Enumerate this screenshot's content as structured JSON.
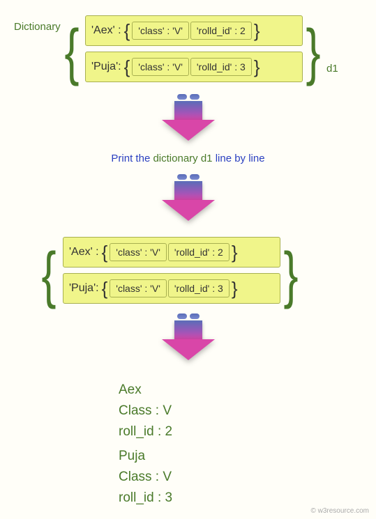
{
  "labels": {
    "dictionary": "Dictionary",
    "d1": "d1"
  },
  "caption": {
    "prefix": "Print the",
    "mid": " dictionary d1 ",
    "suffix": "line by line"
  },
  "dict1": {
    "row1": {
      "key": "'Aex' :",
      "kv1": "'class' : 'V'",
      "kv2": "'rolld_id' : 2"
    },
    "row2": {
      "key": "'Puja':",
      "kv1": "'class' : 'V'",
      "kv2": "'rolld_id' : 3"
    }
  },
  "dict2": {
    "row1": {
      "key": "'Aex' :",
      "kv1": "'class' : 'V'",
      "kv2": "'rolld_id' : 2"
    },
    "row2": {
      "key": "'Puja':",
      "kv1": "'class' : 'V'",
      "kv2": "'rolld_id' : 3"
    }
  },
  "output": {
    "l1": "Aex",
    "l2": "Class : V",
    "l3": "roll_id : 2",
    "l4": "Puja",
    "l5": "Class : V",
    "l6": "roll_id : 3"
  },
  "footer": "© w3resource.com"
}
